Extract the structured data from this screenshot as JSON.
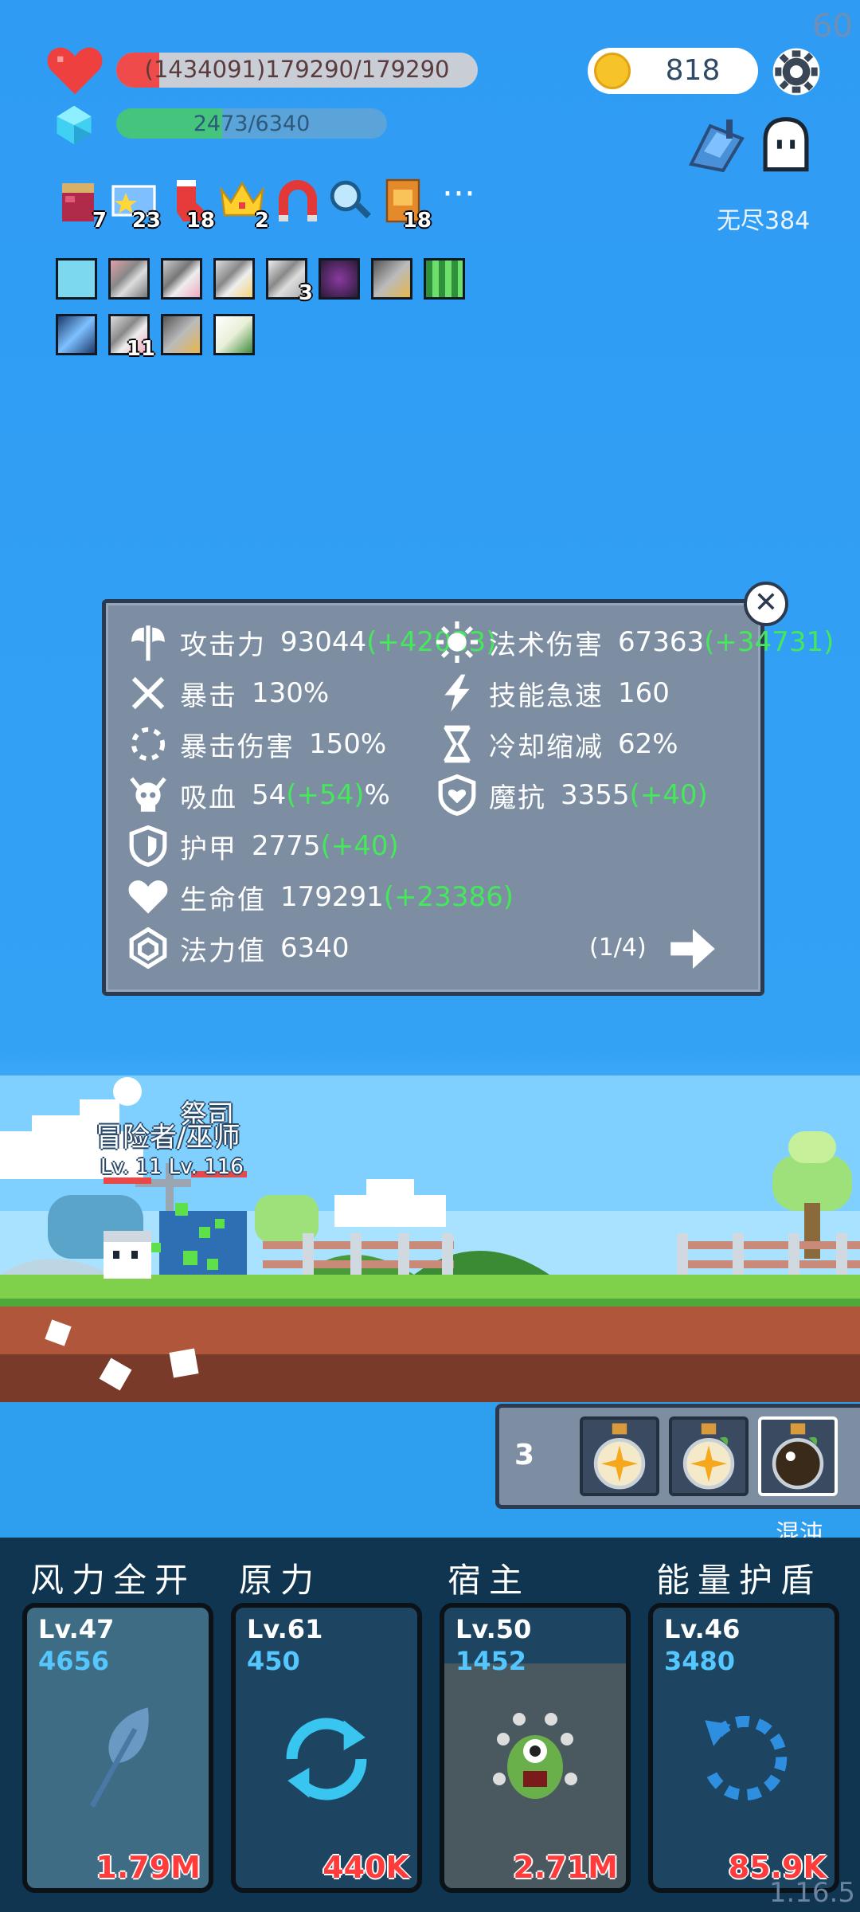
{
  "hud": {
    "fps": "60",
    "hp_text": "(1434091)179290/179290",
    "mp_text": "2473/6340",
    "mp_fraction": 0.39,
    "coins": "818",
    "endless_label": "无尽384",
    "version": "1.16.5"
  },
  "inventory": [
    {
      "icon": "jam-jar-icon",
      "count": "7"
    },
    {
      "icon": "star-card-icon",
      "count": "23"
    },
    {
      "icon": "red-sock-icon",
      "count": "18"
    },
    {
      "icon": "crown-icon",
      "count": "2"
    },
    {
      "icon": "magnet-icon",
      "count": ""
    },
    {
      "icon": "magnifier-icon",
      "count": ""
    },
    {
      "icon": "spellbook-icon",
      "count": "18"
    }
  ],
  "buffs_row1_counts": [
    "",
    "",
    "",
    "",
    "3",
    "",
    "",
    ""
  ],
  "buffs_row2_counts": [
    "",
    "11",
    "",
    ""
  ],
  "stats": {
    "attack_label": "攻击力",
    "attack_value": "93044",
    "attack_bonus": "(+42033)",
    "spell_label": "法术伤害",
    "spell_value": "67363",
    "spell_bonus": "(+34731)",
    "crit_label": "暴击",
    "crit_value": "130%",
    "haste_label": "技能急速",
    "haste_value": "160",
    "critdmg_label": "暴击伤害",
    "critdmg_value": "150%",
    "cdr_label": "冷却缩减",
    "cdr_value": "62%",
    "lifesteal_label": "吸血",
    "lifesteal_value": "54",
    "lifesteal_bonus": "(+54)",
    "lifesteal_unit": "%",
    "mres_label": "魔抗",
    "mres_value": "3355",
    "mres_bonus": "(+40)",
    "armor_label": "护甲",
    "armor_value": "2775",
    "armor_bonus": "(+40)",
    "hp_label": "生命值",
    "hp_value": "179291",
    "hp_bonus": "(+23386)",
    "mana_label": "法力值",
    "mana_value": "6340",
    "page": "(1/4)"
  },
  "scene": {
    "priest_label": "祭司",
    "adventurer_label": "冒险者/巫师",
    "level_label": "Lv. 11 Lv. 116"
  },
  "potions": {
    "count": "3",
    "selected_label": "混沌"
  },
  "skills": [
    {
      "name": "风力全开",
      "level": "Lv.47",
      "cost": "4656",
      "damage": "1.79M",
      "icon": "feather-icon"
    },
    {
      "name": "原力",
      "level": "Lv.61",
      "cost": "450",
      "damage": "440K",
      "icon": "refresh-arrows-icon"
    },
    {
      "name": "宿主",
      "level": "Lv.50",
      "cost": "1452",
      "damage": "2.71M",
      "icon": "eyeball-monster-icon"
    },
    {
      "name": "能量护盾",
      "level": "Lv.46",
      "cost": "3480",
      "damage": "85.9K",
      "icon": "dashed-cycle-icon"
    }
  ],
  "colors": {
    "sky": "#33a2f5",
    "panel": "#7d8ea3",
    "bonus_green": "#44e85a",
    "damage_red": "#ff3b3b",
    "cost_blue": "#55c7ff"
  }
}
